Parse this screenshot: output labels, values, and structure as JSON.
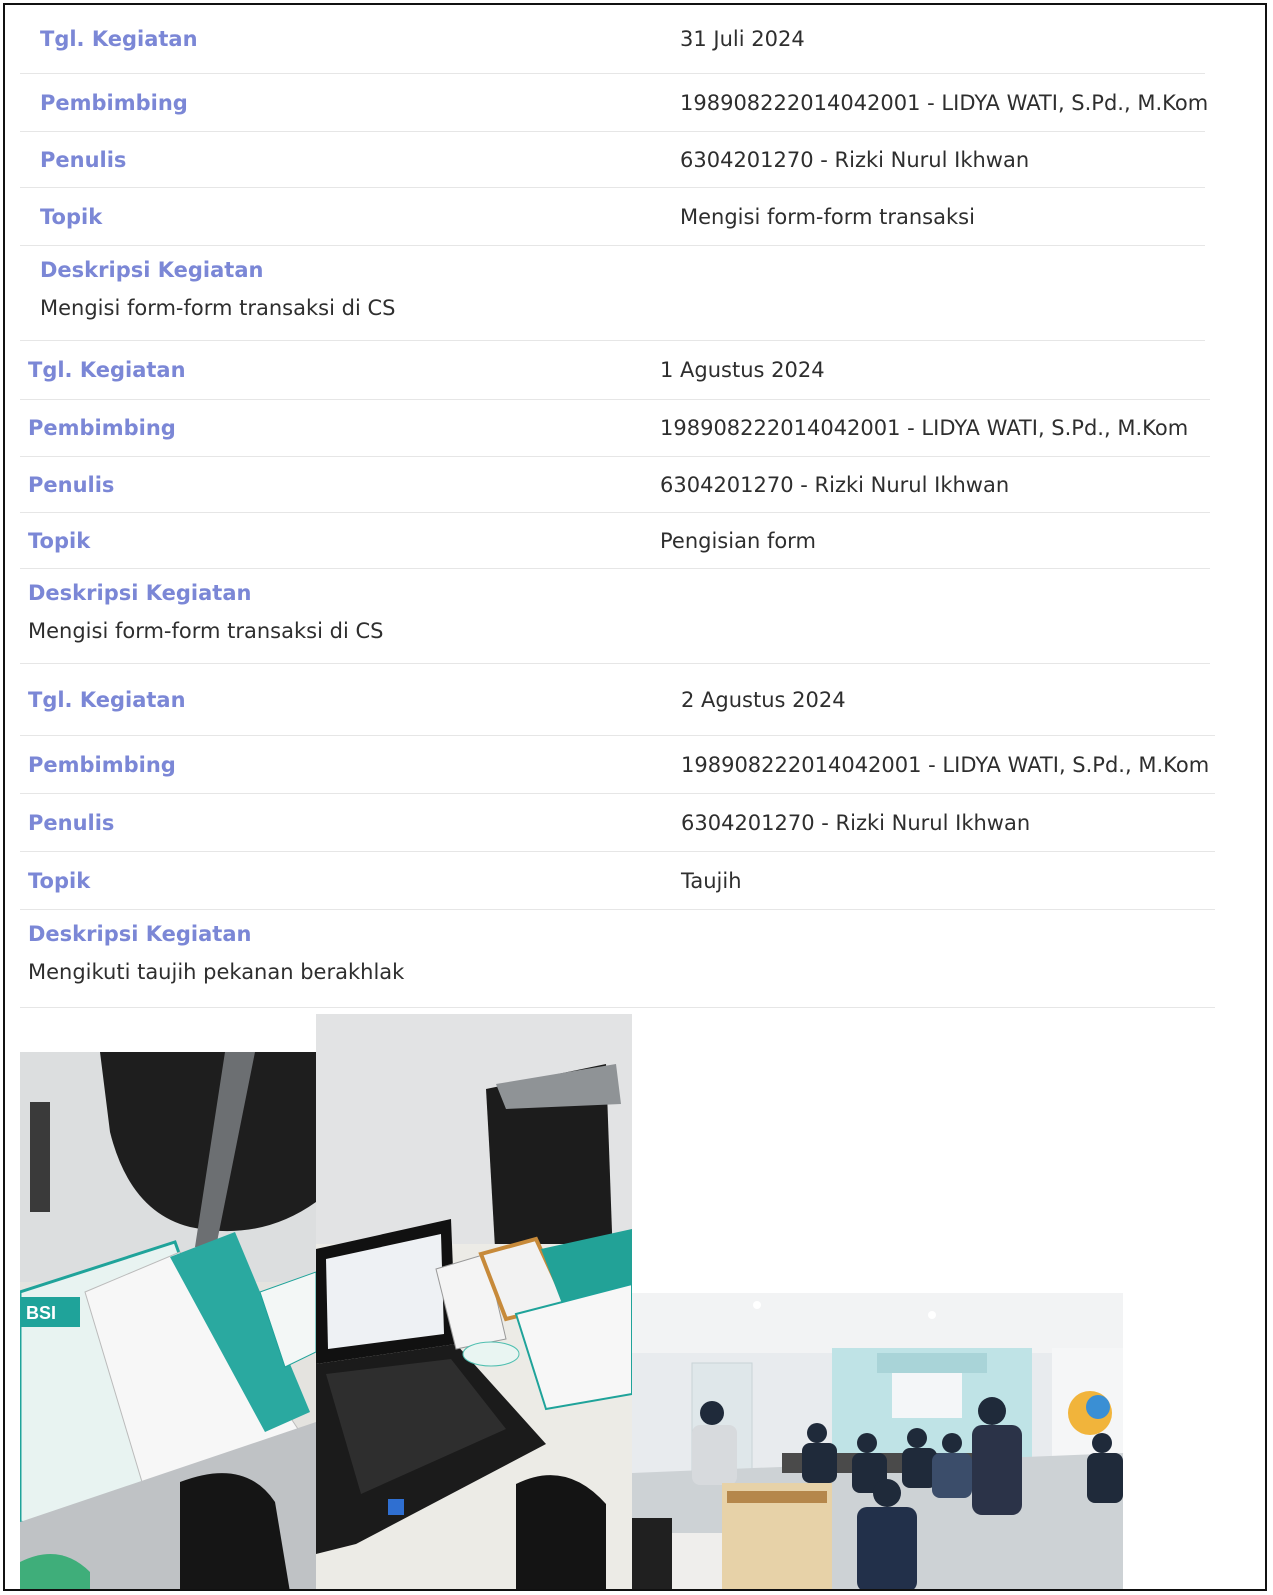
{
  "labels": {
    "date": "Tgl. Kegiatan",
    "supervisor": "Pembimbing",
    "writer": "Penulis",
    "topic": "Topik",
    "description": "Deskripsi Kegiatan"
  },
  "entries": [
    {
      "date": "31 Juli 2024",
      "supervisor": "198908222014042001 - LIDYA WATI, S.Pd., M.Kom",
      "writer": "6304201270 - Rizki Nurul Ikhwan",
      "topic": "Mengisi form-form transaksi",
      "description": "Mengisi form-form transaksi di CS"
    },
    {
      "date": "1 Agustus 2024",
      "supervisor": "198908222014042001 - LIDYA WATI, S.Pd., M.Kom",
      "writer": "6304201270 - Rizki Nurul Ikhwan",
      "topic": "Pengisian form",
      "description": "Mengisi form-form transaksi di CS"
    },
    {
      "date": "2 Agustus 2024",
      "supervisor": "198908222014042001 - LIDYA WATI, S.Pd., M.Kom",
      "writer": "6304201270 - Rizki Nurul Ikhwan",
      "topic": "Taujih",
      "description": "Mengikuti taujih pekanan berakhlak"
    }
  ],
  "photos": {
    "logo_text": "BSI"
  },
  "colors": {
    "label": "#7b87d6",
    "text": "#2e2e2e",
    "divider": "#e6e6e6",
    "brand_green": "#1fa39a"
  }
}
